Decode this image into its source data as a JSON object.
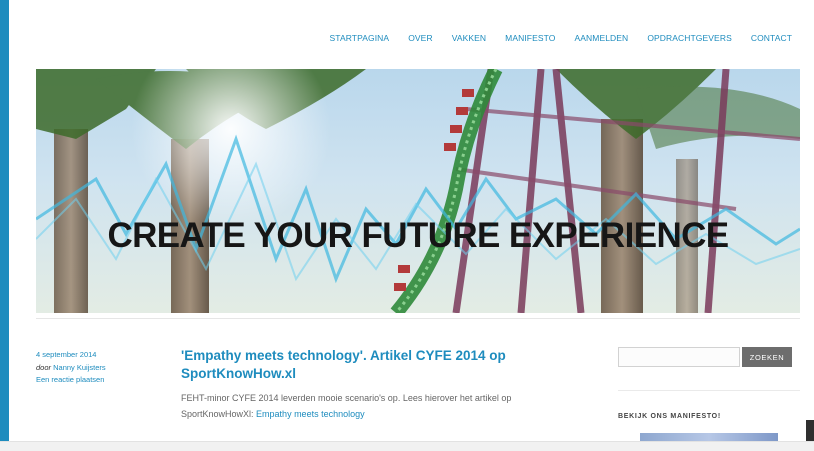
{
  "nav": {
    "items": [
      "STARTPAGINA",
      "OVER",
      "VAKKEN",
      "MANIFESTO",
      "AANMELDEN",
      "OPDRACHTGEVERS",
      "CONTACT"
    ]
  },
  "hero": {
    "title": "CREATE YOUR FUTURE EXPERIENCE"
  },
  "post": {
    "date": "4 september 2014",
    "by": "door",
    "author": "Nanny Kuijsters",
    "reply": "Een reactie plaatsen",
    "title": "'Empathy meets technology'. Artikel CYFE 2014 op SportKnowHow.xl",
    "body": "FEHT-minor CYFE 2014 leverden mooie scenario's op. Lees hierover het artikel op SportKnowHowXl: ",
    "link": "Empathy meets technology"
  },
  "sidebar": {
    "search_button": "ZOEKEN",
    "widget_title": "BEKIJK ONS MANIFESTO!"
  },
  "colors": {
    "accent": "#1e8cbe",
    "text": "#666666"
  }
}
